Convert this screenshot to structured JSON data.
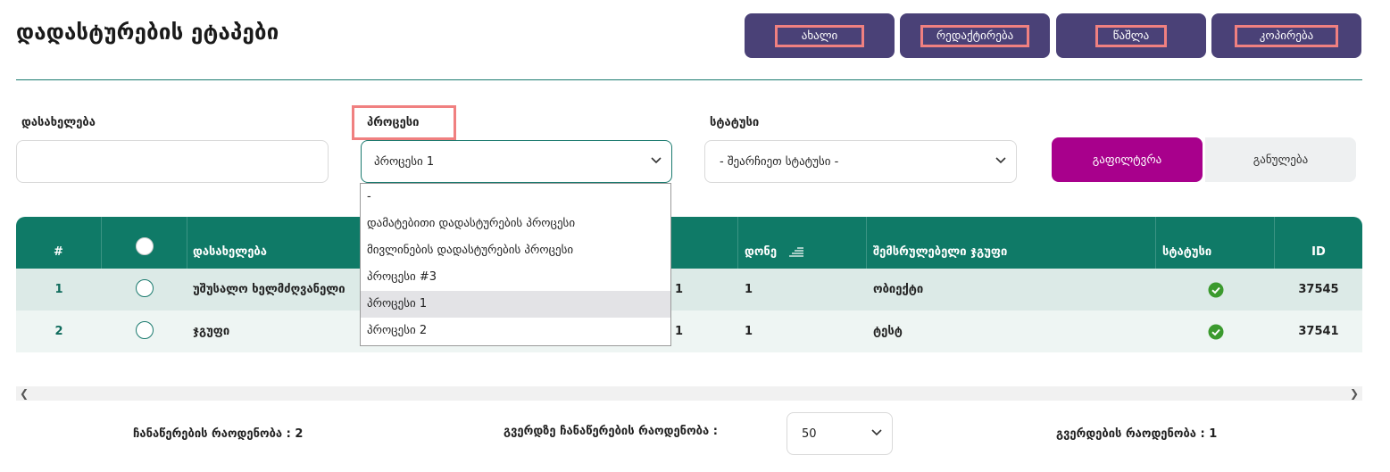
{
  "page": {
    "title": "დადასტურების ეტაპები"
  },
  "toolbar": {
    "new_label": "ახალი",
    "edit_label": "რედაქტირება",
    "delete_label": "წაშლა",
    "copy_label": "კოპირება"
  },
  "filters": {
    "name_label": "დასახელება",
    "name_value": "",
    "process_label": "პროცესი",
    "process_value": "პროცესი 1",
    "status_label": "სტატუსი",
    "status_value": "- შეარჩიეთ სტატუსი -",
    "filter_button": "გაფილტვრა",
    "reset_button": "განულება"
  },
  "process_dropdown": {
    "options": [
      "-",
      "დამატებითი დადასტურების პროცესი",
      "მივლინების დადასტურების პროცესი",
      "პროცესი #3",
      "პროცესი 1",
      "პროცესი 2"
    ],
    "selected": "პროცესი 1"
  },
  "table": {
    "headers": {
      "num": "#",
      "name": "დასახელება",
      "level": "დონე",
      "group": "შემსრულებელი ჯგუფი",
      "status": "სტატუსი",
      "id": "ID"
    },
    "rows": [
      {
        "num": "1",
        "name": "უშუსალო ხელმძღვანელი",
        "count": "1",
        "level": "1",
        "group": "ობიექტი",
        "status": "active",
        "id": "37545"
      },
      {
        "num": "2",
        "name": "ჯგუფი",
        "count": "1",
        "level": "1",
        "group": "ტესტ",
        "status": "active",
        "id": "37541"
      }
    ]
  },
  "pagination": {
    "total_label": "ჩანაწერების რაოდენობა : 2",
    "per_page_label": "გვერდზე ჩანაწერების რაოდენობა :",
    "per_page_value": "50",
    "pages_label": "გვერდების რაოდენობა : 1"
  },
  "colors": {
    "toolbar_button": "#4a4177",
    "table_header": "#0f7a67",
    "filter_button": "#a8008c",
    "highlight": "#f08080",
    "accent": "#1a7a6e"
  },
  "icons": {
    "select_arrow": "chevron-down-icon",
    "sort": "sort-icon",
    "status_ok": "check-circle-icon"
  }
}
